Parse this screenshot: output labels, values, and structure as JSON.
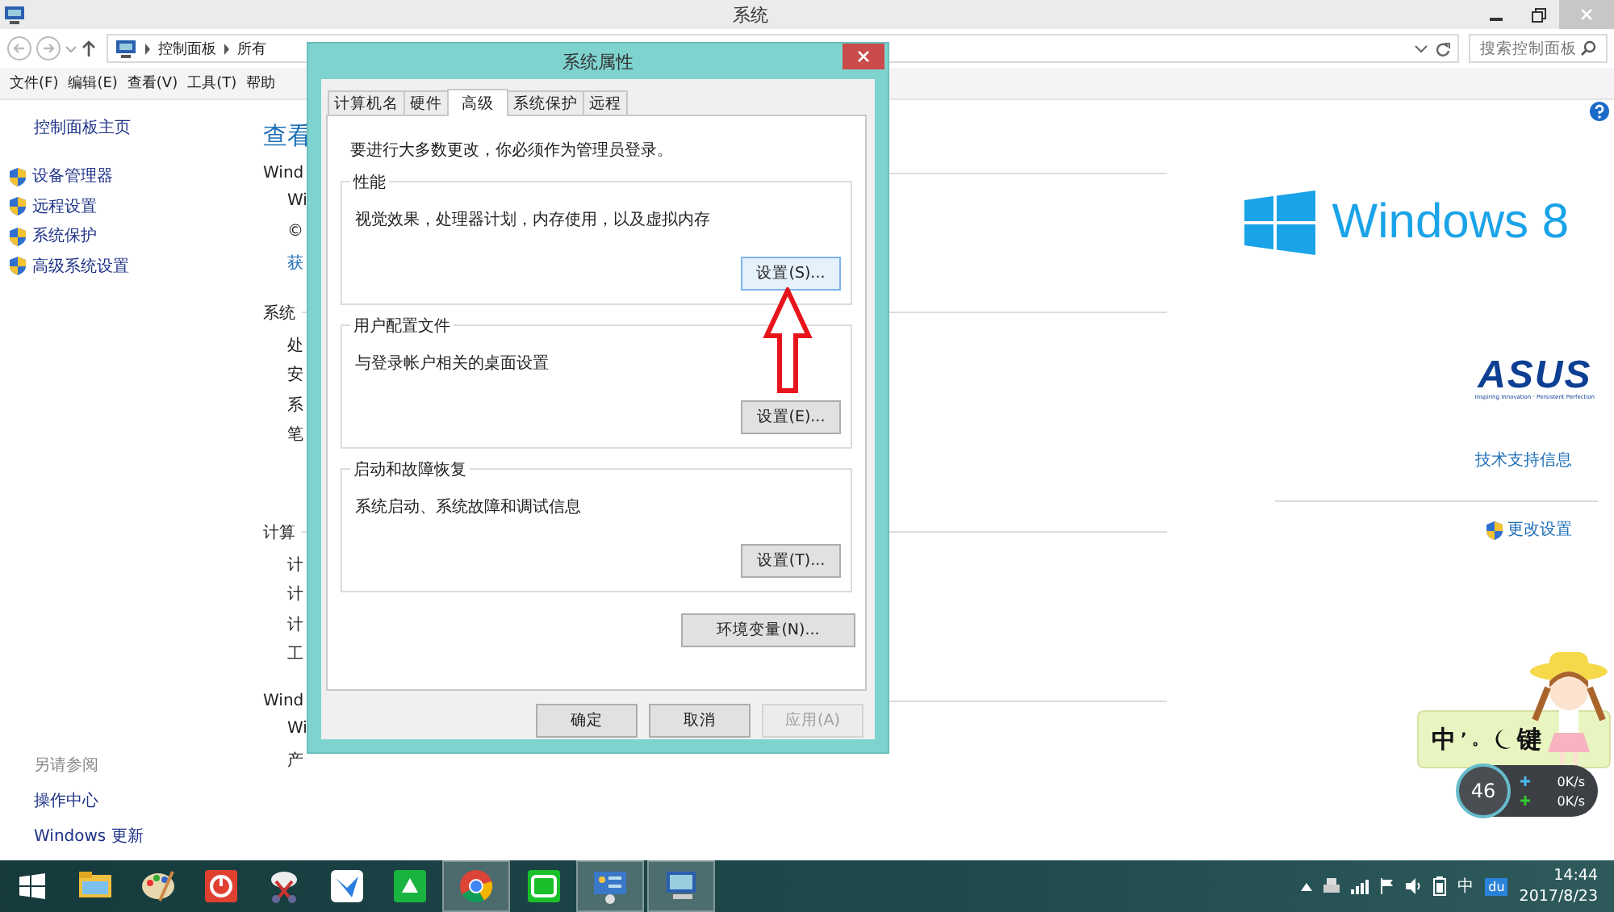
{
  "window": {
    "title": "系统"
  },
  "nav": {
    "breadcrumb": [
      "控制面板",
      "所有"
    ],
    "search": {
      "placeholder": "搜索控制面板"
    }
  },
  "menu": [
    "文件(F)",
    "编辑(E)",
    "查看(V)",
    "工具(T)",
    "帮助"
  ],
  "sidebar": {
    "home": "控制面板主页",
    "items": [
      "设备管理器",
      "远程设置",
      "系统保护",
      "高级系统设置"
    ],
    "see_also": {
      "heading": "另请参阅",
      "links": [
        "操作中心",
        "Windows 更新"
      ]
    }
  },
  "content": {
    "heading": "查看",
    "sections": [
      {
        "title": "Wind",
        "rows": [
          {
            "text": "Wi",
            "kind": "text"
          },
          {
            "text": "©",
            "kind": "text"
          },
          {
            "text": "获",
            "kind": "link"
          }
        ]
      },
      {
        "title": "系统",
        "rows": [
          {
            "text": "处",
            "kind": "text"
          },
          {
            "text": "安",
            "kind": "text"
          },
          {
            "text": "系",
            "kind": "text"
          },
          {
            "text": "笔",
            "kind": "text"
          }
        ]
      },
      {
        "title": "计算",
        "rows": [
          {
            "text": "计",
            "kind": "text"
          },
          {
            "text": "计",
            "kind": "text"
          },
          {
            "text": "计",
            "kind": "text"
          },
          {
            "text": "工",
            "kind": "text"
          }
        ]
      },
      {
        "title": "Wind",
        "rows": [
          {
            "text": "Wi",
            "kind": "text"
          },
          {
            "text": "产",
            "kind": "text"
          }
        ]
      }
    ]
  },
  "brand": {
    "windows_logo": "Windows",
    "windows_version": "8",
    "oem_logo": "ASUS",
    "oem_tagline": "Inspiring Innovation · Persistent Perfection",
    "support_link": "技术支持信息",
    "change_link": "更改设置"
  },
  "dialog": {
    "title": "系统属性",
    "tabs": [
      {
        "label": "计算机名",
        "selected": false
      },
      {
        "label": "硬件",
        "selected": false
      },
      {
        "label": "高级",
        "selected": true
      },
      {
        "label": "系统保护",
        "selected": false
      },
      {
        "label": "远程",
        "selected": false
      }
    ],
    "note": "要进行大多数更改，你必须作为管理员登录。",
    "groups": [
      {
        "title": "性能",
        "description": "视觉效果，处理器计划，内存使用，以及虚拟内存",
        "button": "设置(S)...",
        "focused": true
      },
      {
        "title": "用户配置文件",
        "description": "与登录帐户相关的桌面设置",
        "button": "设置(E)...",
        "focused": false
      },
      {
        "title": "启动和故障恢复",
        "description": "系统启动、系统故障和调试信息",
        "button": "设置(T)...",
        "focused": false
      }
    ],
    "env_button": "环境变量(N)...",
    "buttons": [
      {
        "label": "确定",
        "disabled": false
      },
      {
        "label": "取消",
        "disabled": false
      },
      {
        "label": "应用(A)",
        "disabled": true
      }
    ]
  },
  "ime": {
    "labels": [
      "中",
      "ʼ",
      "。",
      "键"
    ]
  },
  "net": {
    "percent": "46",
    "up": "0K/s",
    "down": "0K/s"
  },
  "taskbar": {
    "apps": [
      {
        "active": false
      },
      {
        "active": false
      },
      {
        "active": false
      },
      {
        "active": false
      },
      {
        "active": false
      },
      {
        "active": false
      },
      {
        "active": true
      },
      {
        "active": false
      },
      {
        "active": true
      },
      {
        "active": true
      }
    ],
    "tray": {
      "ime": "中",
      "badge": "du",
      "time": "14:44",
      "date": "2017/8/23"
    }
  }
}
